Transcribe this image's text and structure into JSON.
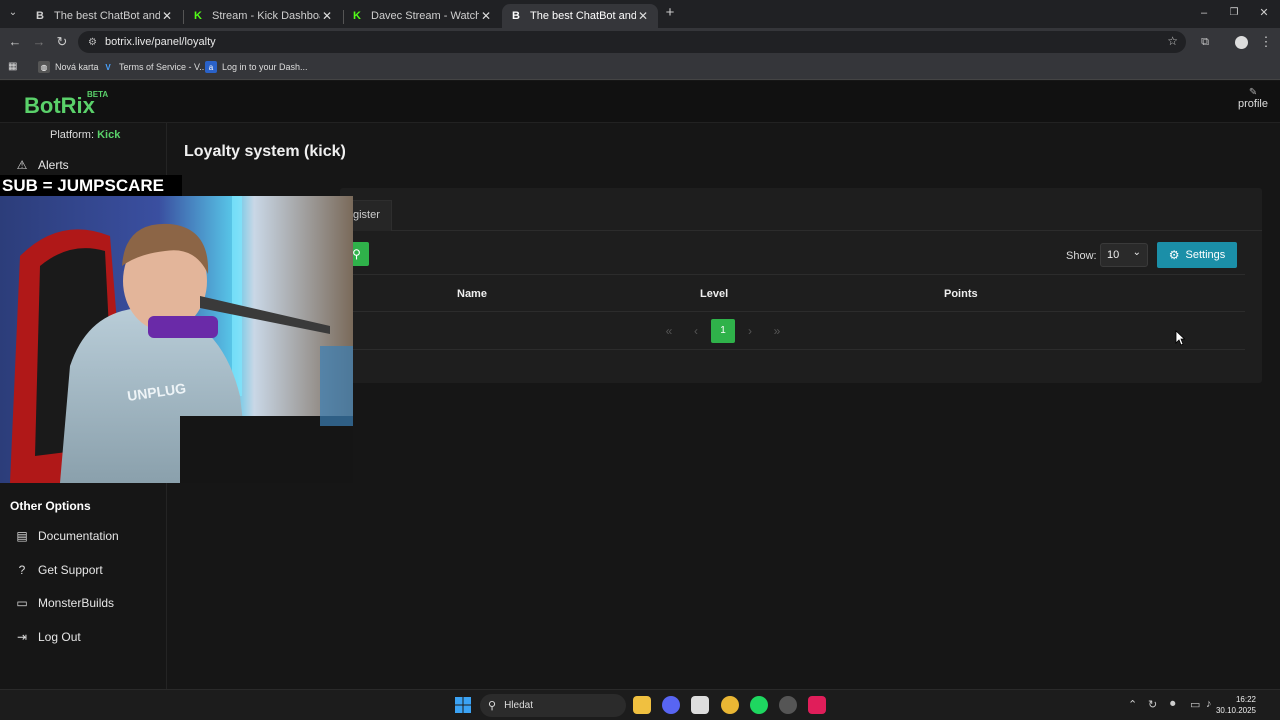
{
  "browser": {
    "tabs": [
      {
        "title": "The best ChatBot and Widgets",
        "favicon": "B",
        "fav_color": "#ffffff",
        "close": "✕"
      },
      {
        "title": "Stream - Kick Dashboard",
        "favicon": "K",
        "fav_color": "#53fc18",
        "close": "✕"
      },
      {
        "title": "Davec Stream - Watch Live on K",
        "favicon": "K",
        "fav_color": "#53fc18",
        "close": "✕"
      },
      {
        "title": "The best ChatBot and Widgets",
        "favicon": "B",
        "fav_color": "#ffffff",
        "close": "✕"
      }
    ],
    "new_tab": "+",
    "url": "botrix.live/panel/loyalty",
    "bookmarks": [
      {
        "label": "Nová karta",
        "icon": "globe-icon"
      },
      {
        "label": "Terms of Service - V...",
        "icon": "v-icon"
      },
      {
        "label": "Log in to your Dash...",
        "icon": "a-icon"
      }
    ]
  },
  "app": {
    "logo": "BotRix",
    "beta": "BETA",
    "profile": "profile",
    "platform_label": "Platform:",
    "platform_value": "Kick"
  },
  "sidebar": {
    "top_items": [
      {
        "label": "Alerts",
        "icon": "warning-icon"
      }
    ],
    "other_options_title": "Other Options",
    "other_items": [
      {
        "label": "Documentation",
        "icon": "book-icon"
      },
      {
        "label": "Get Support",
        "icon": "question-icon"
      },
      {
        "label": "MonsterBuilds",
        "icon": "laptop-icon"
      },
      {
        "label": "Log Out",
        "icon": "logout-icon"
      }
    ]
  },
  "main": {
    "title": "Loyalty system (kick)",
    "tab_label": "gister",
    "show_label": "Show:",
    "show_value": "10",
    "settings_label": "Settings",
    "columns": [
      "Name",
      "Level",
      "Points"
    ],
    "pagination": {
      "first": "«",
      "prev": "‹",
      "current": "1",
      "next": "›",
      "last": "»"
    }
  },
  "overlay": {
    "sub_text": "SUB = JUMPSCARE"
  },
  "taskbar": {
    "search_placeholder": "Hledat",
    "time": "16:22",
    "date": "30.10.2025"
  },
  "colors": {
    "accent_green": "#2fb24a",
    "settings_teal": "#1b8fa8",
    "logo_green": "#5ad16a"
  }
}
